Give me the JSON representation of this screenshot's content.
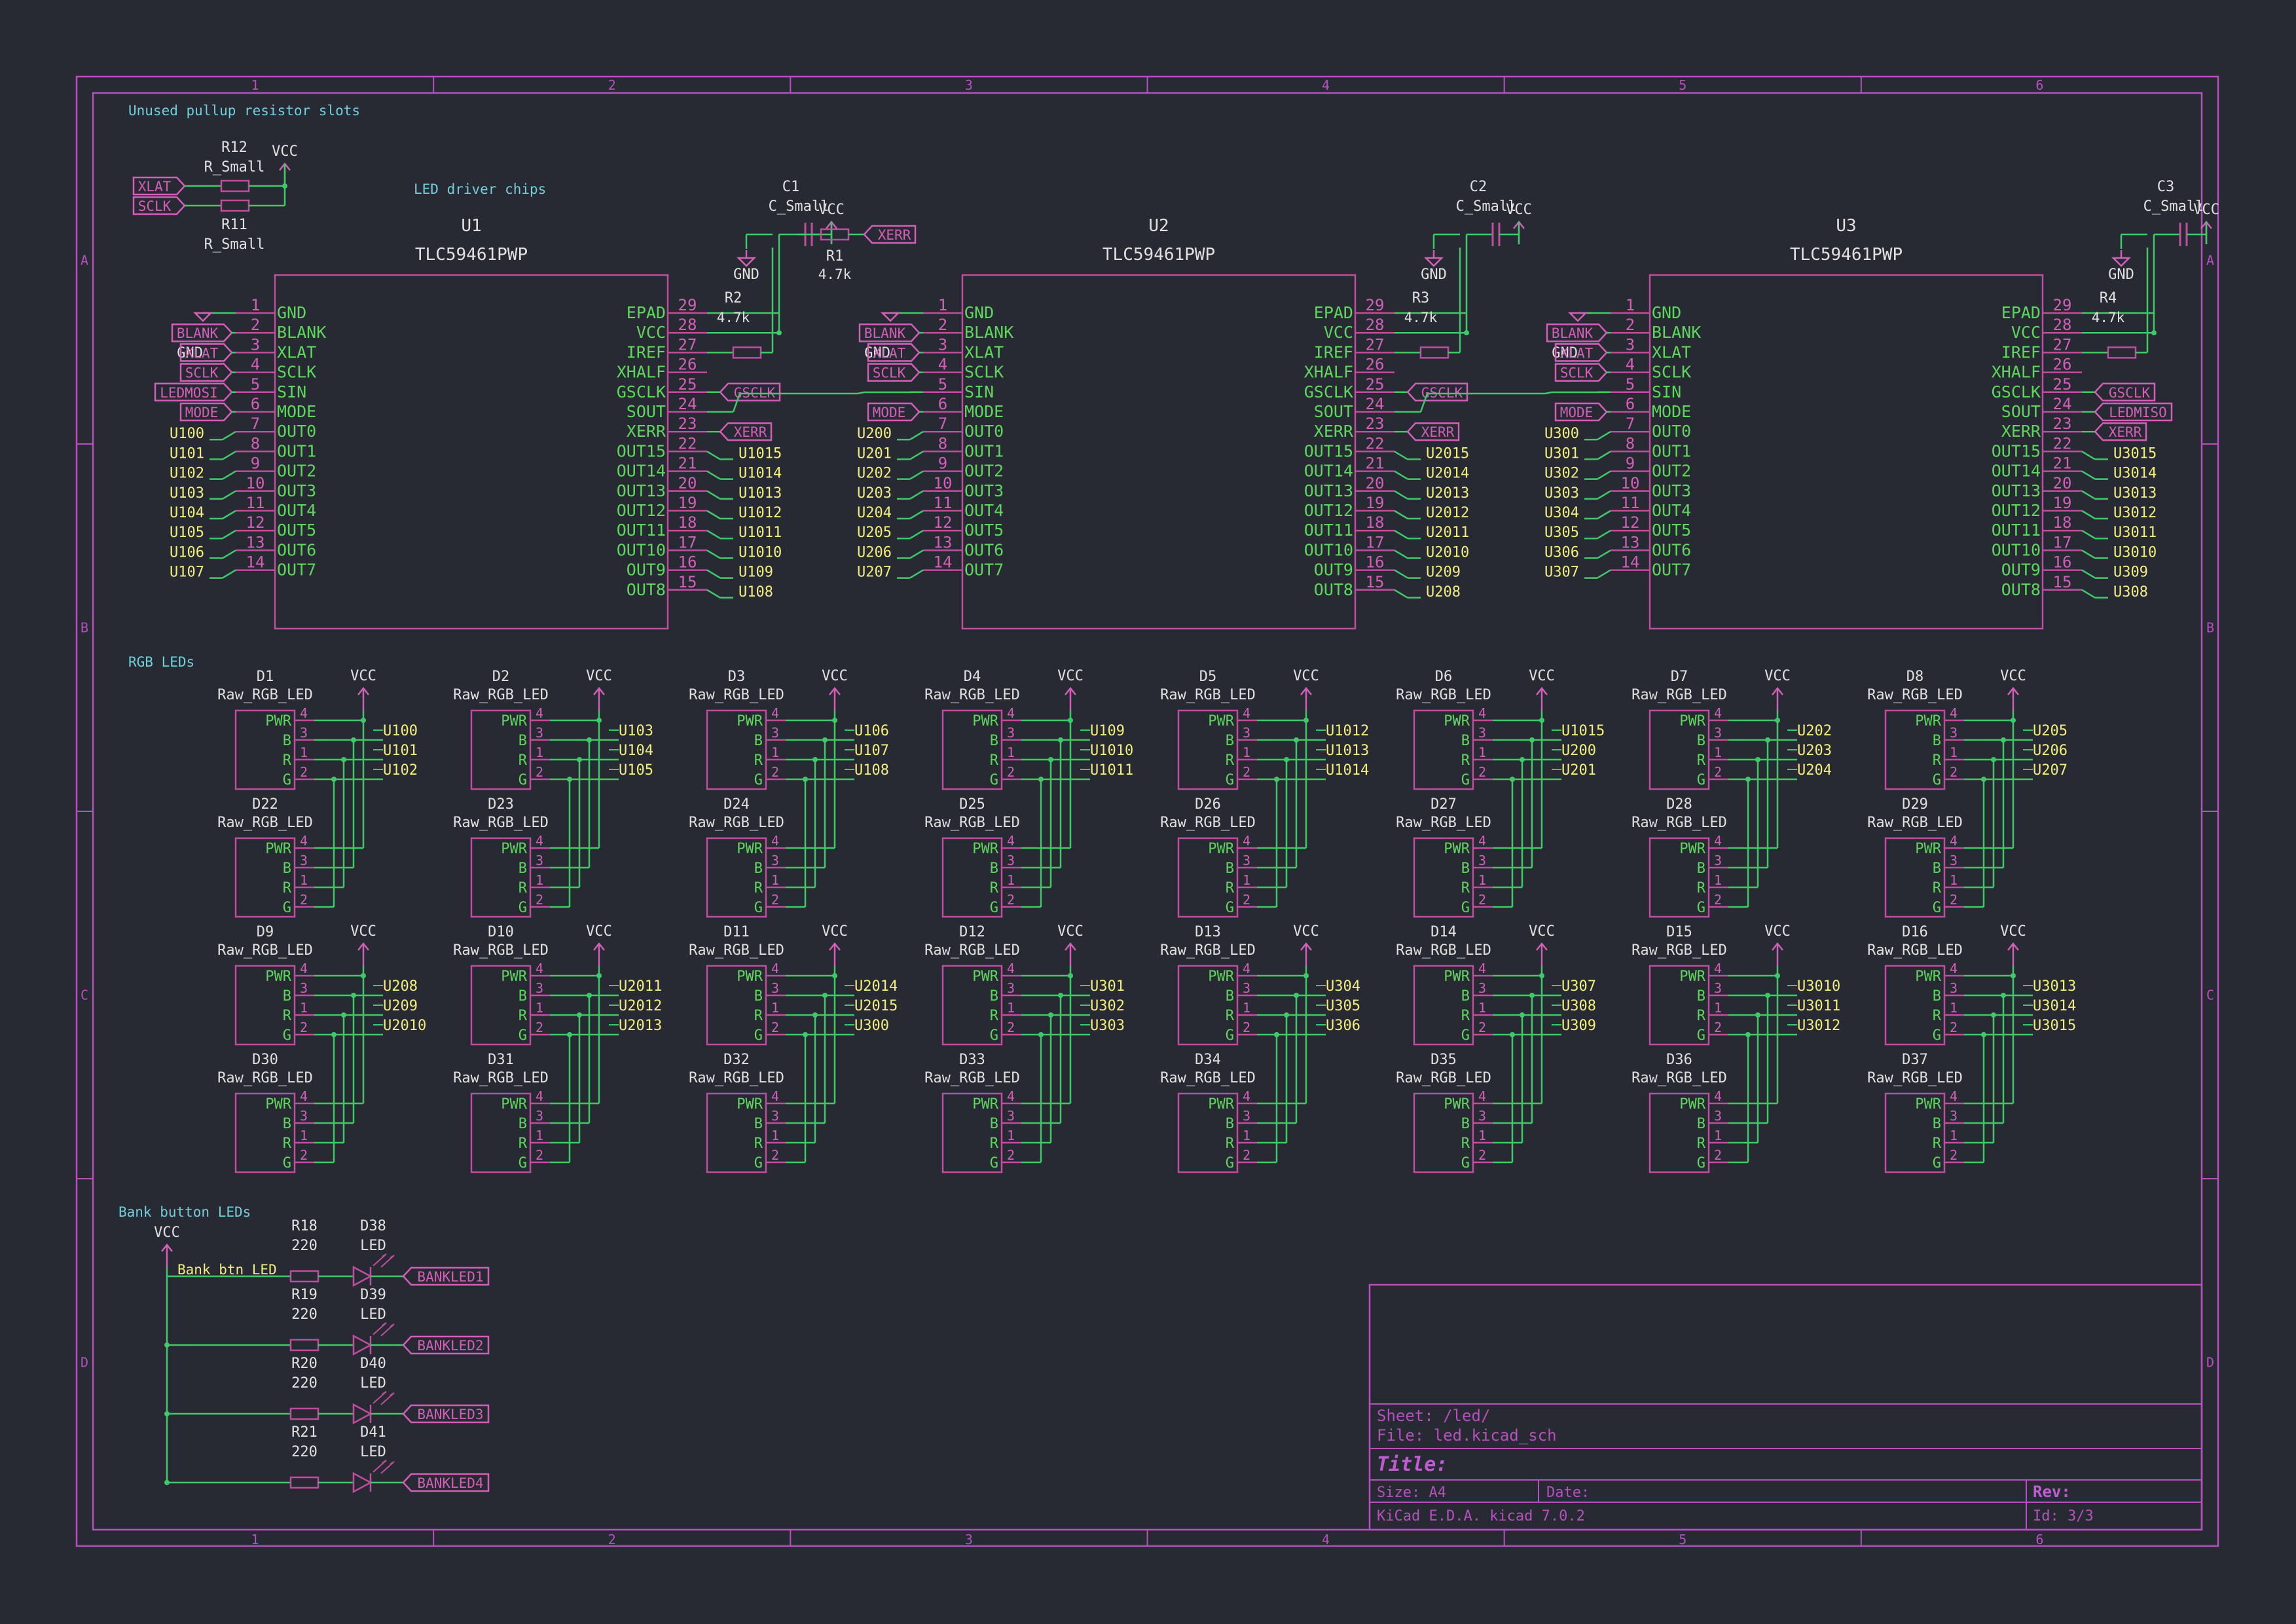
{
  "colors": {
    "background": "#272a33",
    "border": "#b84fc0",
    "body": "#c04d9e",
    "pin_name": "#5ed65e",
    "pin_num": "#d45fb8",
    "wire": "#3fc96a",
    "net_label": "#f2ee7d",
    "power": "#d45fb8",
    "text_cyan": "#6fd0dc",
    "ref": "#e0e0e0",
    "title_magenta": "#c05cd0"
  },
  "frame": {
    "cols": [
      "1",
      "2",
      "3",
      "4",
      "5",
      "6"
    ],
    "rows": [
      "A",
      "B",
      "C",
      "D"
    ]
  },
  "sections": {
    "pullup": "Unused pullup resistor slots",
    "driver": "LED driver chips",
    "rgb": "RGB LEDs",
    "bank": "Bank button LEDs"
  },
  "pullups": {
    "vcc": "VCC",
    "r12": {
      "ref": "R12",
      "value": "R_Small"
    },
    "r11": {
      "ref": "R11",
      "value": "R_Small"
    },
    "labels": [
      "XLAT",
      "SCLK"
    ]
  },
  "chips": [
    {
      "ref": "U1",
      "part": "TLC59461PWP",
      "cap_ref": "C1",
      "cap_val": "C_Small",
      "res_ref": "R2",
      "res_val": "4.7k",
      "left_pins": [
        [
          "GND",
          "1"
        ],
        [
          "BLANK",
          "2"
        ],
        [
          "XLAT",
          "3"
        ],
        [
          "SCLK",
          "4"
        ],
        [
          "SIN",
          "5"
        ],
        [
          "MODE",
          "6"
        ],
        [
          "OUT0",
          "7"
        ],
        [
          "OUT1",
          "8"
        ],
        [
          "OUT2",
          "9"
        ],
        [
          "OUT3",
          "10"
        ],
        [
          "OUT4",
          "11"
        ],
        [
          "OUT5",
          "12"
        ],
        [
          "OUT6",
          "13"
        ],
        [
          "OUT7",
          "14"
        ]
      ],
      "right_pins": [
        [
          "EPAD",
          "29"
        ],
        [
          "VCC",
          "28"
        ],
        [
          "IREF",
          "27"
        ],
        [
          "XHALF",
          "26"
        ],
        [
          "GSCLK",
          "25"
        ],
        [
          "SOUT",
          "24"
        ],
        [
          "XERR",
          "23"
        ],
        [
          "OUT15",
          "22"
        ],
        [
          "OUT14",
          "21"
        ],
        [
          "OUT13",
          "20"
        ],
        [
          "OUT12",
          "19"
        ],
        [
          "OUT11",
          "18"
        ],
        [
          "OUT10",
          "17"
        ],
        [
          "OUT9",
          "16"
        ],
        [
          "OUT8",
          "15"
        ]
      ],
      "left_labels": [
        "BLANK",
        "XLAT",
        "SCLK",
        "LEDMOSI",
        "MODE"
      ],
      "left_nets": [
        "U100",
        "U101",
        "U102",
        "U103",
        "U104",
        "U105",
        "U106",
        "U107"
      ],
      "right_labels": [
        "GSCLK",
        "XERR"
      ],
      "right_nets": [
        "U1015",
        "U1014",
        "U1013",
        "U1012",
        "U1011",
        "U1010",
        "U109",
        "U108"
      ],
      "gnd": "GND"
    },
    {
      "ref": "U2",
      "part": "TLC59461PWP",
      "cap_ref": "C2",
      "cap_val": "C_Small",
      "res_ref": "R3",
      "res_val": "4.7k",
      "left_pins": [
        [
          "GND",
          "1"
        ],
        [
          "BLANK",
          "2"
        ],
        [
          "XLAT",
          "3"
        ],
        [
          "SCLK",
          "4"
        ],
        [
          "SIN",
          "5"
        ],
        [
          "MODE",
          "6"
        ],
        [
          "OUT0",
          "7"
        ],
        [
          "OUT1",
          "8"
        ],
        [
          "OUT2",
          "9"
        ],
        [
          "OUT3",
          "10"
        ],
        [
          "OUT4",
          "11"
        ],
        [
          "OUT5",
          "12"
        ],
        [
          "OUT6",
          "13"
        ],
        [
          "OUT7",
          "14"
        ]
      ],
      "right_pins": [
        [
          "EPAD",
          "29"
        ],
        [
          "VCC",
          "28"
        ],
        [
          "IREF",
          "27"
        ],
        [
          "XHALF",
          "26"
        ],
        [
          "GSCLK",
          "25"
        ],
        [
          "SOUT",
          "24"
        ],
        [
          "XERR",
          "23"
        ],
        [
          "OUT15",
          "22"
        ],
        [
          "OUT14",
          "21"
        ],
        [
          "OUT13",
          "20"
        ],
        [
          "OUT12",
          "19"
        ],
        [
          "OUT11",
          "18"
        ],
        [
          "OUT10",
          "17"
        ],
        [
          "OUT9",
          "16"
        ],
        [
          "OUT8",
          "15"
        ]
      ],
      "left_labels": [
        "BLANK",
        "XLAT",
        "SCLK",
        "MODE"
      ],
      "left_nets": [
        "U200",
        "U201",
        "U202",
        "U203",
        "U204",
        "U205",
        "U206",
        "U207"
      ],
      "right_labels": [
        "GSCLK",
        "XERR"
      ],
      "right_nets": [
        "U2015",
        "U2014",
        "U2013",
        "U2012",
        "U2011",
        "U2010",
        "U209",
        "U208"
      ],
      "gnd": "GND"
    },
    {
      "ref": "U3",
      "part": "TLC59461PWP",
      "cap_ref": "C3",
      "cap_val": "C_Small",
      "res_ref": "R4",
      "res_val": "4.7k",
      "left_pins": [
        [
          "GND",
          "1"
        ],
        [
          "BLANK",
          "2"
        ],
        [
          "XLAT",
          "3"
        ],
        [
          "SCLK",
          "4"
        ],
        [
          "SIN",
          "5"
        ],
        [
          "MODE",
          "6"
        ],
        [
          "OUT0",
          "7"
        ],
        [
          "OUT1",
          "8"
        ],
        [
          "OUT2",
          "9"
        ],
        [
          "OUT3",
          "10"
        ],
        [
          "OUT4",
          "11"
        ],
        [
          "OUT5",
          "12"
        ],
        [
          "OUT6",
          "13"
        ],
        [
          "OUT7",
          "14"
        ]
      ],
      "right_pins": [
        [
          "EPAD",
          "29"
        ],
        [
          "VCC",
          "28"
        ],
        [
          "IREF",
          "27"
        ],
        [
          "XHALF",
          "26"
        ],
        [
          "GSCLK",
          "25"
        ],
        [
          "SOUT",
          "24"
        ],
        [
          "XERR",
          "23"
        ],
        [
          "OUT15",
          "22"
        ],
        [
          "OUT14",
          "21"
        ],
        [
          "OUT13",
          "20"
        ],
        [
          "OUT12",
          "19"
        ],
        [
          "OUT11",
          "18"
        ],
        [
          "OUT10",
          "17"
        ],
        [
          "OUT9",
          "16"
        ],
        [
          "OUT8",
          "15"
        ]
      ],
      "left_labels": [
        "BLANK",
        "XLAT",
        "SCLK",
        "MODE"
      ],
      "left_nets": [
        "U300",
        "U301",
        "U302",
        "U303",
        "U304",
        "U305",
        "U306",
        "U307"
      ],
      "right_labels": [
        "GSCLK",
        "LEDMISO",
        "XERR"
      ],
      "right_nets": [
        "U3015",
        "U3014",
        "U3013",
        "U3012",
        "U3011",
        "U3010",
        "U309",
        "U308"
      ],
      "gnd": "GND"
    }
  ],
  "r1": {
    "ref": "R1",
    "value": "4.7k",
    "label": "XERR"
  },
  "vcc": "VCC",
  "gnd": "GND",
  "led_value": "Raw_RGB_LED",
  "led_pins": {
    "names": [
      "PWR",
      "B",
      "R",
      "G"
    ],
    "nums": [
      "4",
      "3",
      "1",
      "2"
    ]
  },
  "led_groups": [
    {
      "top": "D1",
      "bottom": "D22",
      "nets": [
        "U100",
        "U101",
        "U102"
      ]
    },
    {
      "top": "D2",
      "bottom": "D23",
      "nets": [
        "U103",
        "U104",
        "U105"
      ]
    },
    {
      "top": "D3",
      "bottom": "D24",
      "nets": [
        "U106",
        "U107",
        "U108"
      ]
    },
    {
      "top": "D4",
      "bottom": "D25",
      "nets": [
        "U109",
        "U1010",
        "U1011"
      ]
    },
    {
      "top": "D5",
      "bottom": "D26",
      "nets": [
        "U1012",
        "U1013",
        "U1014"
      ]
    },
    {
      "top": "D6",
      "bottom": "D27",
      "nets": [
        "U1015",
        "U200",
        "U201"
      ]
    },
    {
      "top": "D7",
      "bottom": "D28",
      "nets": [
        "U202",
        "U203",
        "U204"
      ]
    },
    {
      "top": "D8",
      "bottom": "D29",
      "nets": [
        "U205",
        "U206",
        "U207"
      ]
    },
    {
      "top": "D9",
      "bottom": "D30",
      "nets": [
        "U208",
        "U209",
        "U2010"
      ]
    },
    {
      "top": "D10",
      "bottom": "D31",
      "nets": [
        "U2011",
        "U2012",
        "U2013"
      ]
    },
    {
      "top": "D11",
      "bottom": "D32",
      "nets": [
        "U2014",
        "U2015",
        "U300"
      ]
    },
    {
      "top": "D12",
      "bottom": "D33",
      "nets": [
        "U301",
        "U302",
        "U303"
      ]
    },
    {
      "top": "D13",
      "bottom": "D34",
      "nets": [
        "U304",
        "U305",
        "U306"
      ]
    },
    {
      "top": "D14",
      "bottom": "D35",
      "nets": [
        "U307",
        "U308",
        "U309"
      ]
    },
    {
      "top": "D15",
      "bottom": "D36",
      "nets": [
        "U3010",
        "U3011",
        "U3012"
      ]
    },
    {
      "top": "D16",
      "bottom": "D37",
      "nets": [
        "U3013",
        "U3014",
        "U3015"
      ]
    }
  ],
  "bank": {
    "vcc": "VCC",
    "net": "Bank btn LED",
    "rows": [
      {
        "r": "R18",
        "rv": "220",
        "d": "D38",
        "dv": "LED",
        "label": "BANKLED1"
      },
      {
        "r": "R19",
        "rv": "220",
        "d": "D39",
        "dv": "LED",
        "label": "BANKLED2"
      },
      {
        "r": "R20",
        "rv": "220",
        "d": "D40",
        "dv": "LED",
        "label": "BANKLED3"
      },
      {
        "r": "R21",
        "rv": "220",
        "d": "D41",
        "dv": "LED",
        "label": "BANKLED4"
      }
    ]
  },
  "title_block": {
    "sheet": "Sheet: /led/",
    "file": "File: led.kicad_sch",
    "title": "Title:",
    "size": "Size: A4",
    "date": "Date:",
    "rev": "Rev:",
    "tool": "KiCad E.D.A.  kicad 7.0.2",
    "id": "Id: 3/3"
  }
}
